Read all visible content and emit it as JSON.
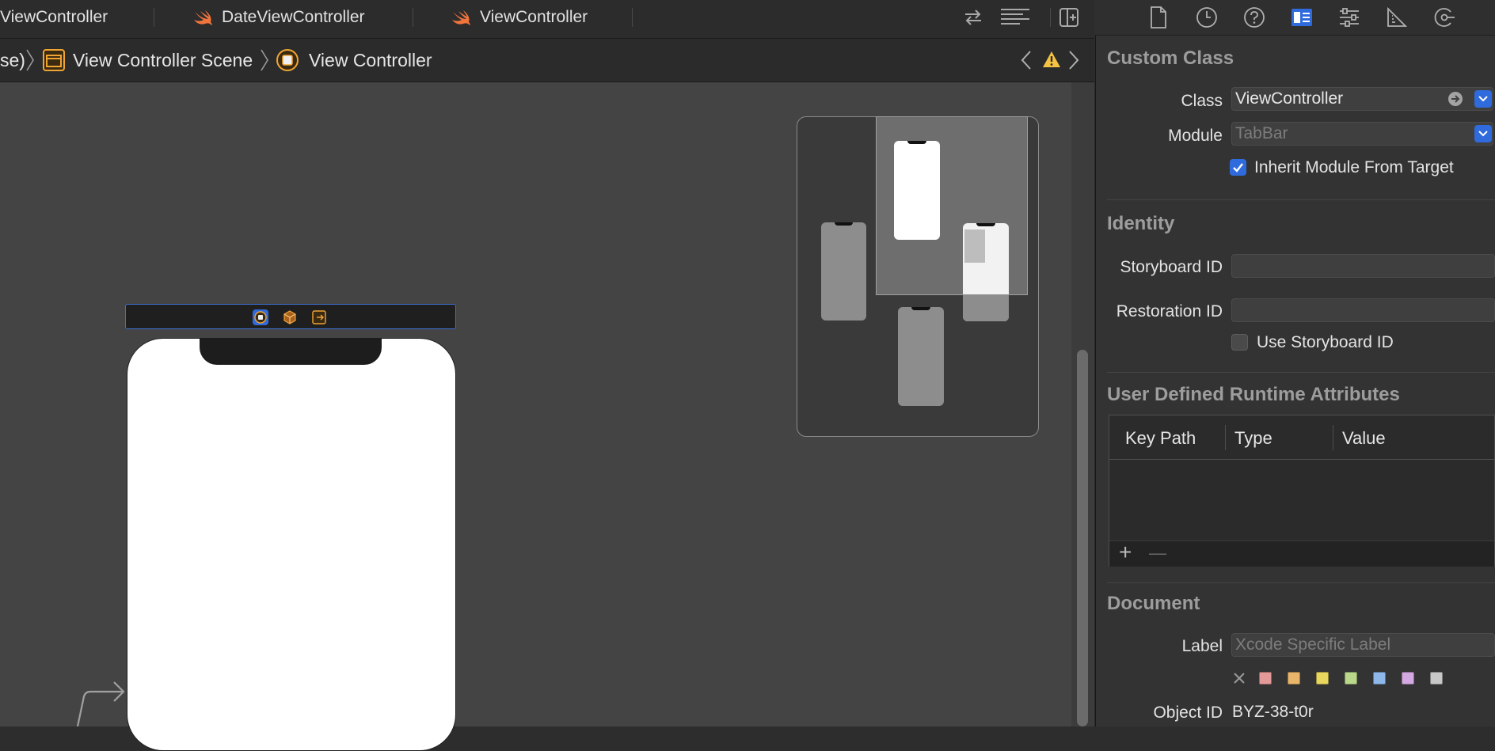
{
  "tabs": [
    {
      "label": "ViewController"
    },
    {
      "label": "DateViewController"
    },
    {
      "label": "ViewController"
    }
  ],
  "jumpbar": {
    "crumb0": "se)",
    "crumb1": "View Controller Scene",
    "crumb2": "View Controller"
  },
  "inspector": {
    "custom_class": {
      "title": "Custom Class",
      "class_label": "Class",
      "class_value": "ViewController",
      "module_label": "Module",
      "module_placeholder": "TabBar",
      "inherit_label": "Inherit Module From Target",
      "inherit_checked": true
    },
    "identity": {
      "title": "Identity",
      "storyboard_id_label": "Storyboard ID",
      "storyboard_id_value": "",
      "restoration_id_label": "Restoration ID",
      "restoration_id_value": "",
      "use_storyboard_label": "Use Storyboard ID",
      "use_storyboard_checked": false
    },
    "runtime_attributes": {
      "title": "User Defined Runtime Attributes",
      "columns": [
        "Key Path",
        "Type",
        "Value"
      ],
      "add_label": "+",
      "remove_label": "—"
    },
    "document": {
      "title": "Document",
      "label_label": "Label",
      "label_placeholder": "Xcode Specific Label",
      "object_id_label": "Object ID",
      "object_id_value": "BYZ-38-t0r",
      "label_colors": [
        "#e59a9a",
        "#e8b56a",
        "#e8d65e",
        "#b9d88a",
        "#8fb8ea",
        "#d4a8e0",
        "#c8c8c8"
      ]
    }
  },
  "colors": {
    "accent": "#2f6bdc",
    "swift": "#f0743b",
    "warning": "#f5c242",
    "scene_icon": "#f0a533"
  }
}
